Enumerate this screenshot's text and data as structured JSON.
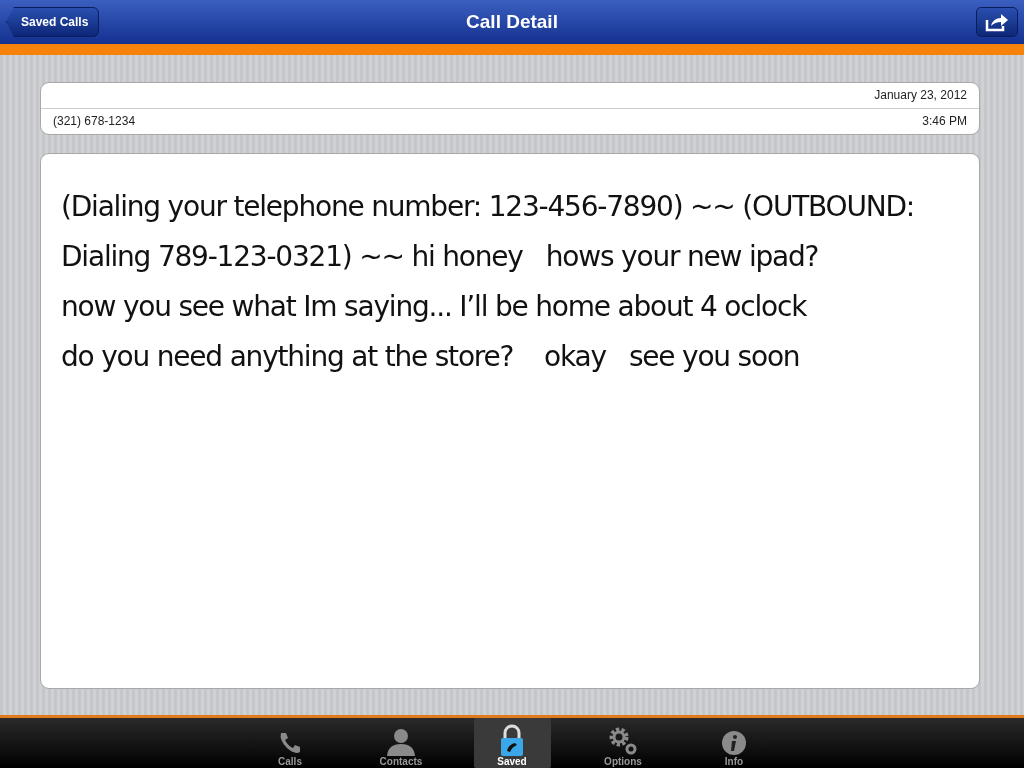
{
  "nav_bar": {
    "back_button": "Saved Calls",
    "title": "Call Detail"
  },
  "call_info": {
    "date": "January 23, 2012",
    "number": "(321) 678-1234",
    "time": "3:46 PM"
  },
  "transcript": {
    "lines": [
      "(Dialing your telephone number: 123-456-7890) ~~ (OUTBOUND:",
      "Dialing 789-123-0321) ~~ hi honey   hows your new ipad?",
      "now you see what Im saying... I’ll be home about 4 oclock",
      "do you need anything at the store?    okay   see you soon"
    ]
  },
  "tab_bar": [
    {
      "kind": "phone",
      "label": "Calls",
      "selected": false
    },
    {
      "kind": "person",
      "label": "Contacts",
      "selected": false
    },
    {
      "kind": "lock",
      "label": "Saved",
      "selected": true
    },
    {
      "kind": "gears",
      "label": "Options",
      "selected": false
    },
    {
      "kind": "info",
      "label": "Info",
      "selected": false
    }
  ]
}
